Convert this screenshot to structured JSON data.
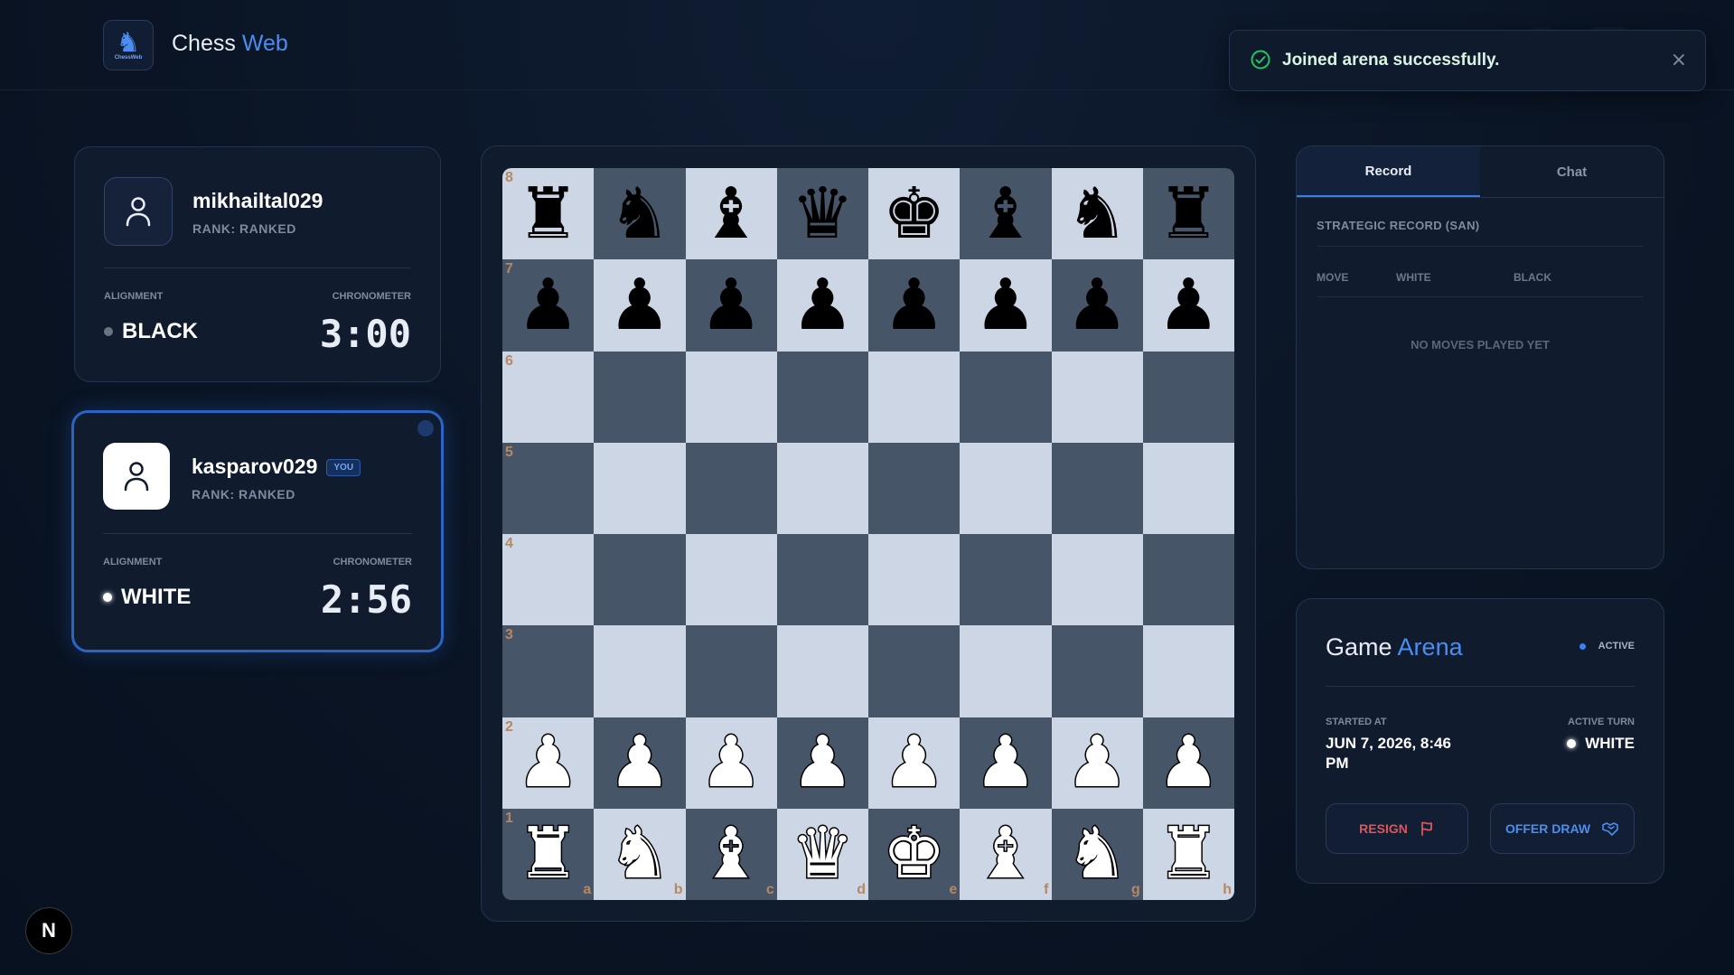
{
  "header": {
    "brand_main": "Chess",
    "brand_accent": "Web",
    "logo_caption": "ChessWeb"
  },
  "toast": {
    "message": "Joined arena successfully.",
    "close_glyph": "×"
  },
  "players": {
    "opponent": {
      "name": "mikhailtal029",
      "rank": "RANK: RANKED",
      "alignment_label": "ALIGNMENT",
      "alignment": "BLACK",
      "chrono_label": "CHRONOMETER",
      "time": "3:00"
    },
    "self": {
      "name": "kasparov029",
      "badge": "YOU",
      "rank": "RANK: RANKED",
      "alignment_label": "ALIGNMENT",
      "alignment": "WHITE",
      "chrono_label": "CHRONOMETER",
      "time": "2:56"
    }
  },
  "board": {
    "rows": [
      [
        "r",
        "n",
        "b",
        "q",
        "k",
        "b",
        "n",
        "r"
      ],
      [
        "p",
        "p",
        "p",
        "p",
        "p",
        "p",
        "p",
        "p"
      ],
      [
        "",
        "",
        "",
        "",
        "",
        "",
        "",
        ""
      ],
      [
        "",
        "",
        "",
        "",
        "",
        "",
        "",
        ""
      ],
      [
        "",
        "",
        "",
        "",
        "",
        "",
        "",
        ""
      ],
      [
        "",
        "",
        "",
        "",
        "",
        "",
        "",
        ""
      ],
      [
        "P",
        "P",
        "P",
        "P",
        "P",
        "P",
        "P",
        "P"
      ],
      [
        "R",
        "N",
        "B",
        "Q",
        "K",
        "B",
        "N",
        "R"
      ]
    ],
    "ranks": [
      "8",
      "7",
      "6",
      "5",
      "4",
      "3",
      "2",
      "1"
    ],
    "files": [
      "a",
      "b",
      "c",
      "d",
      "e",
      "f",
      "g",
      "h"
    ],
    "light_color": "#cdd6e4",
    "dark_color": "#475569"
  },
  "record": {
    "tab_record": "Record",
    "tab_chat": "Chat",
    "title": "STRATEGIC RECORD (SAN)",
    "col_move": "MOVE",
    "col_white": "WHITE",
    "col_black": "BLACK",
    "empty": "NO MOVES PLAYED YET"
  },
  "arena": {
    "title_main": "Game",
    "title_accent": "Arena",
    "status": "ACTIVE",
    "started_label": "STARTED AT",
    "started_value": "JUN 7, 2026, 8:46 PM",
    "turn_label": "ACTIVE TURN",
    "turn_value": "WHITE",
    "resign_label": "RESIGN",
    "draw_label": "OFFER DRAW"
  },
  "footer": {
    "badge": "N"
  },
  "colors": {
    "accent": "#4b8df0",
    "danger": "#e0545a",
    "success": "#22c55e"
  }
}
